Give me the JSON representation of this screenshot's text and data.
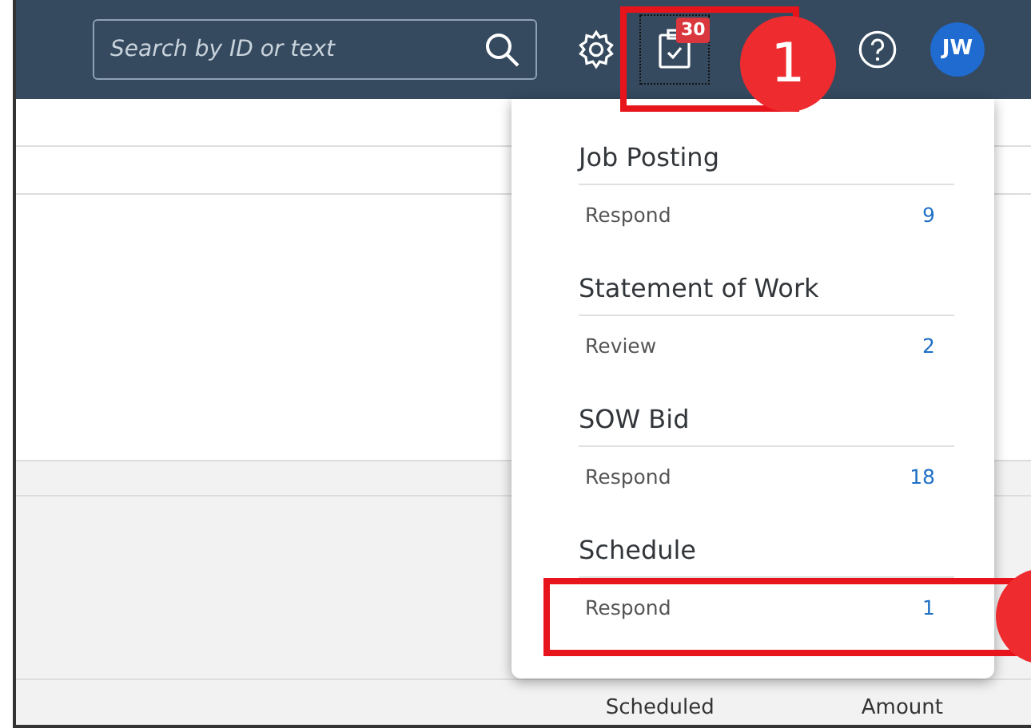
{
  "search": {
    "placeholder": "Search by ID or text"
  },
  "notifications": {
    "count": "30"
  },
  "avatar": {
    "initials": "JW"
  },
  "popover": {
    "groups": [
      {
        "title": "Job Posting",
        "items": [
          {
            "label": "Respond",
            "count": "9"
          }
        ]
      },
      {
        "title": "Statement of Work",
        "items": [
          {
            "label": "Review",
            "count": "2"
          }
        ]
      },
      {
        "title": "SOW Bid",
        "items": [
          {
            "label": "Respond",
            "count": "18"
          }
        ]
      },
      {
        "title": "Schedule",
        "items": [
          {
            "label": "Respond",
            "count": "1"
          }
        ]
      }
    ]
  },
  "table": {
    "columns": [
      "Scheduled",
      "Amount"
    ]
  },
  "callouts": [
    {
      "kind": "numbered",
      "number": "1"
    },
    {
      "kind": "edge"
    }
  ]
}
